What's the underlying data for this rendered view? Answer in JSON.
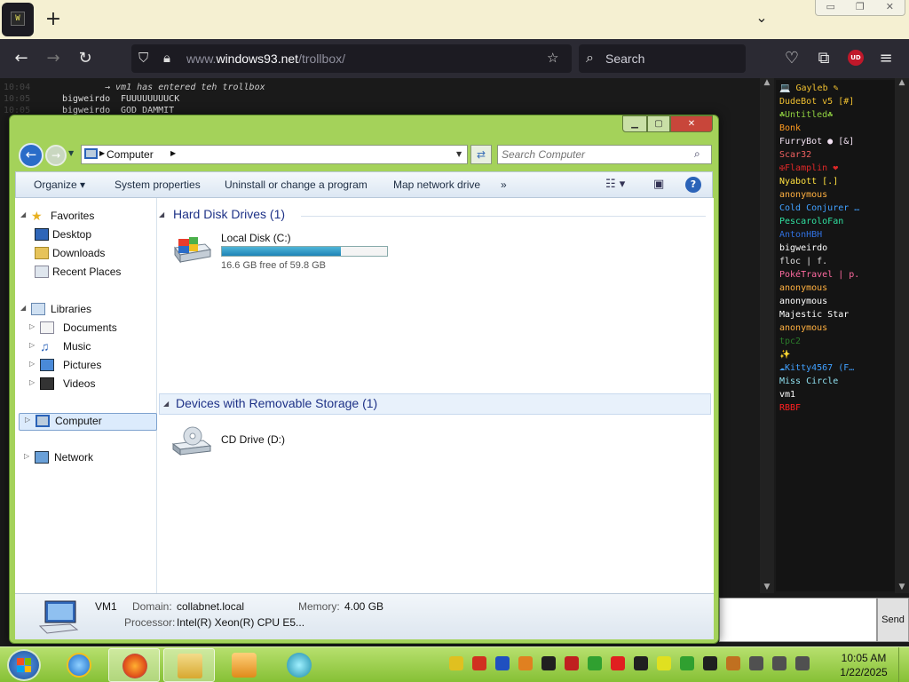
{
  "browser": {
    "tab_icon_text": "W",
    "new_tab_glyph": "+",
    "tab_list_glyph": "⌄",
    "url_prefix": "www.",
    "url_domain": "windows93.net",
    "url_path": "/trollbox/",
    "search_placeholder": "Search",
    "ud_badge": "UD",
    "window_caps": {
      "minimize": "▭",
      "restore": "❐",
      "close": "✕"
    }
  },
  "trollbox": {
    "lines": [
      {
        "time": "10:04",
        "nick": "",
        "msg": "→  vm1 has entered teh trollbox",
        "system": true
      },
      {
        "time": "10:05",
        "nick": "bigweirdo",
        "msg": "FUUUUUUUUCK",
        "system": false
      },
      {
        "time": "10:05",
        "nick": "bigweirdo",
        "msg": "GOD DAMMIT",
        "system": false
      }
    ],
    "users": [
      {
        "name": "💻 Gayleb ✎",
        "color": "#f0c030"
      },
      {
        "name": "DudeBot v5 [#]",
        "color": "#f0c030"
      },
      {
        "name": "☘Untitled☘",
        "color": "#8fcf40"
      },
      {
        "name": "Bonk",
        "color": "#ff9a1f"
      },
      {
        "name": "FurryBot ● [&]",
        "color": "#f0e0f0"
      },
      {
        "name": "Scar32",
        "color": "#f06060"
      },
      {
        "name": "✠Flamplin ❤",
        "color": "#e02828"
      },
      {
        "name": "Nyabott [.]",
        "color": "#ffe040"
      },
      {
        "name": "anonymous",
        "color": "#ffb040"
      },
      {
        "name": "Cold Conjurer …",
        "color": "#40a0ff"
      },
      {
        "name": "PescaroloFan",
        "color": "#30e0a0"
      },
      {
        "name": "AntonHBH",
        "color": "#3070e0"
      },
      {
        "name": "bigweirdo",
        "color": "#ffffff"
      },
      {
        "name": "floc | f.",
        "color": "#e0e0e0"
      },
      {
        "name": "PokéTravel | p.",
        "color": "#ff6aa0"
      },
      {
        "name": "anonymous",
        "color": "#ffb040"
      },
      {
        "name": "anonymous",
        "color": "#ffffff"
      },
      {
        "name": "Majestic Star",
        "color": "#ffffff"
      },
      {
        "name": "anonymous",
        "color": "#ffb040"
      },
      {
        "name": "tpc2",
        "color": "#2a7a2a"
      },
      {
        "name": "✨",
        "color": "#3a5a9a"
      },
      {
        "name": "☁Kitty4567 (F…",
        "color": "#40a0ff"
      },
      {
        "name": "Miss Circle",
        "color": "#8fe0f0"
      },
      {
        "name": "vm1",
        "color": "#ffffff"
      },
      {
        "name": "RBBF",
        "color": "#ff2020"
      }
    ],
    "send_label": "Send"
  },
  "explorer": {
    "address_crumb": "Computer",
    "search_placeholder": "Search Computer",
    "commands": {
      "organize": "Organize",
      "system_properties": "System properties",
      "uninstall": "Uninstall or change a program",
      "map_drive": "Map network drive",
      "more": "»"
    },
    "nav": {
      "favorites": "Favorites",
      "desktop": "Desktop",
      "downloads": "Downloads",
      "recent": "Recent Places",
      "libraries": "Libraries",
      "documents": "Documents",
      "music": "Music",
      "pictures": "Pictures",
      "videos": "Videos",
      "computer": "Computer",
      "network": "Network"
    },
    "groups": {
      "hdd": "Hard Disk Drives (1)",
      "removable": "Devices with Removable Storage (1)"
    },
    "drives": {
      "c": {
        "name": "Local Disk (C:)",
        "free": "16.6 GB free of 59.8 GB",
        "used_percent": 72
      },
      "d": {
        "name": "CD Drive (D:)"
      }
    },
    "details": {
      "name": "VM1",
      "domain_label": "Domain:",
      "domain_value": "collabnet.local",
      "memory_label": "Memory:",
      "memory_value": "4.00 GB",
      "processor_label": "Processor:",
      "processor_value": "Intel(R) Xeon(R) CPU E5..."
    }
  },
  "taskbar": {
    "time": "10:05 AM",
    "date": "1/22/2025"
  },
  "colors": {
    "taskbar": "#9ccf4a",
    "window_frame": "#a4d25a",
    "accent_blue": "#2a6cc8",
    "capacity_fill": "#2a95c5"
  }
}
